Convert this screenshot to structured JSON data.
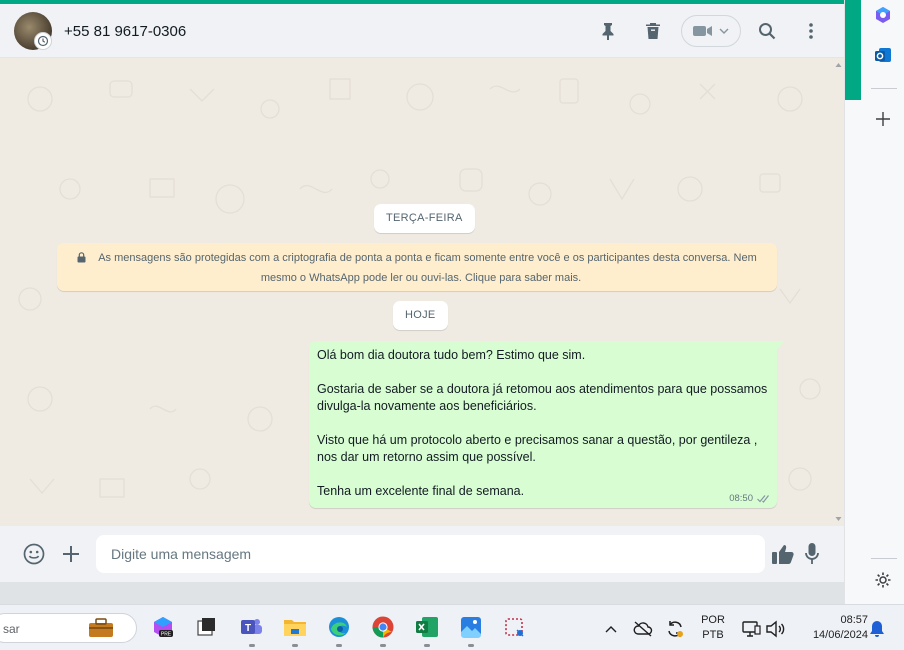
{
  "header": {
    "contact_name": "+55 81 9617-0306"
  },
  "chat": {
    "date_pills": [
      "TERÇA-FEIRA",
      "HOJE"
    ],
    "encryption_notice": "As mensagens são protegidas com a criptografia de ponta a ponta e ficam somente entre você e os participantes desta conversa. Nem mesmo o WhatsApp pode ler ou ouvi-las. Clique para saber mais.",
    "messages": [
      {
        "direction": "outgoing",
        "text": "Olá bom dia doutora tudo bem? Estimo que sim.\n\nGostaria de saber se a doutora já retomou aos atendimentos para que possamos divulga-la novamente aos beneficiários.\n\nVisto que há um protocolo aberto e precisamos sanar a questão, por gentileza , nos dar um retorno assim que possível.\n\nTenha um excelente final de semana.",
        "time": "08:50",
        "status": "delivered"
      }
    ]
  },
  "composer": {
    "placeholder": "Digite uma mensagem"
  },
  "taskbar": {
    "search_text": "sar",
    "language_line1": "POR",
    "language_line2": "PTB",
    "time": "08:57",
    "date": "14/06/2024"
  },
  "colors": {
    "accent": "#00a884",
    "outgoing_bubble": "#d9fdd3",
    "notice_bg": "#ffeecd",
    "chat_bg": "#efeae2"
  }
}
